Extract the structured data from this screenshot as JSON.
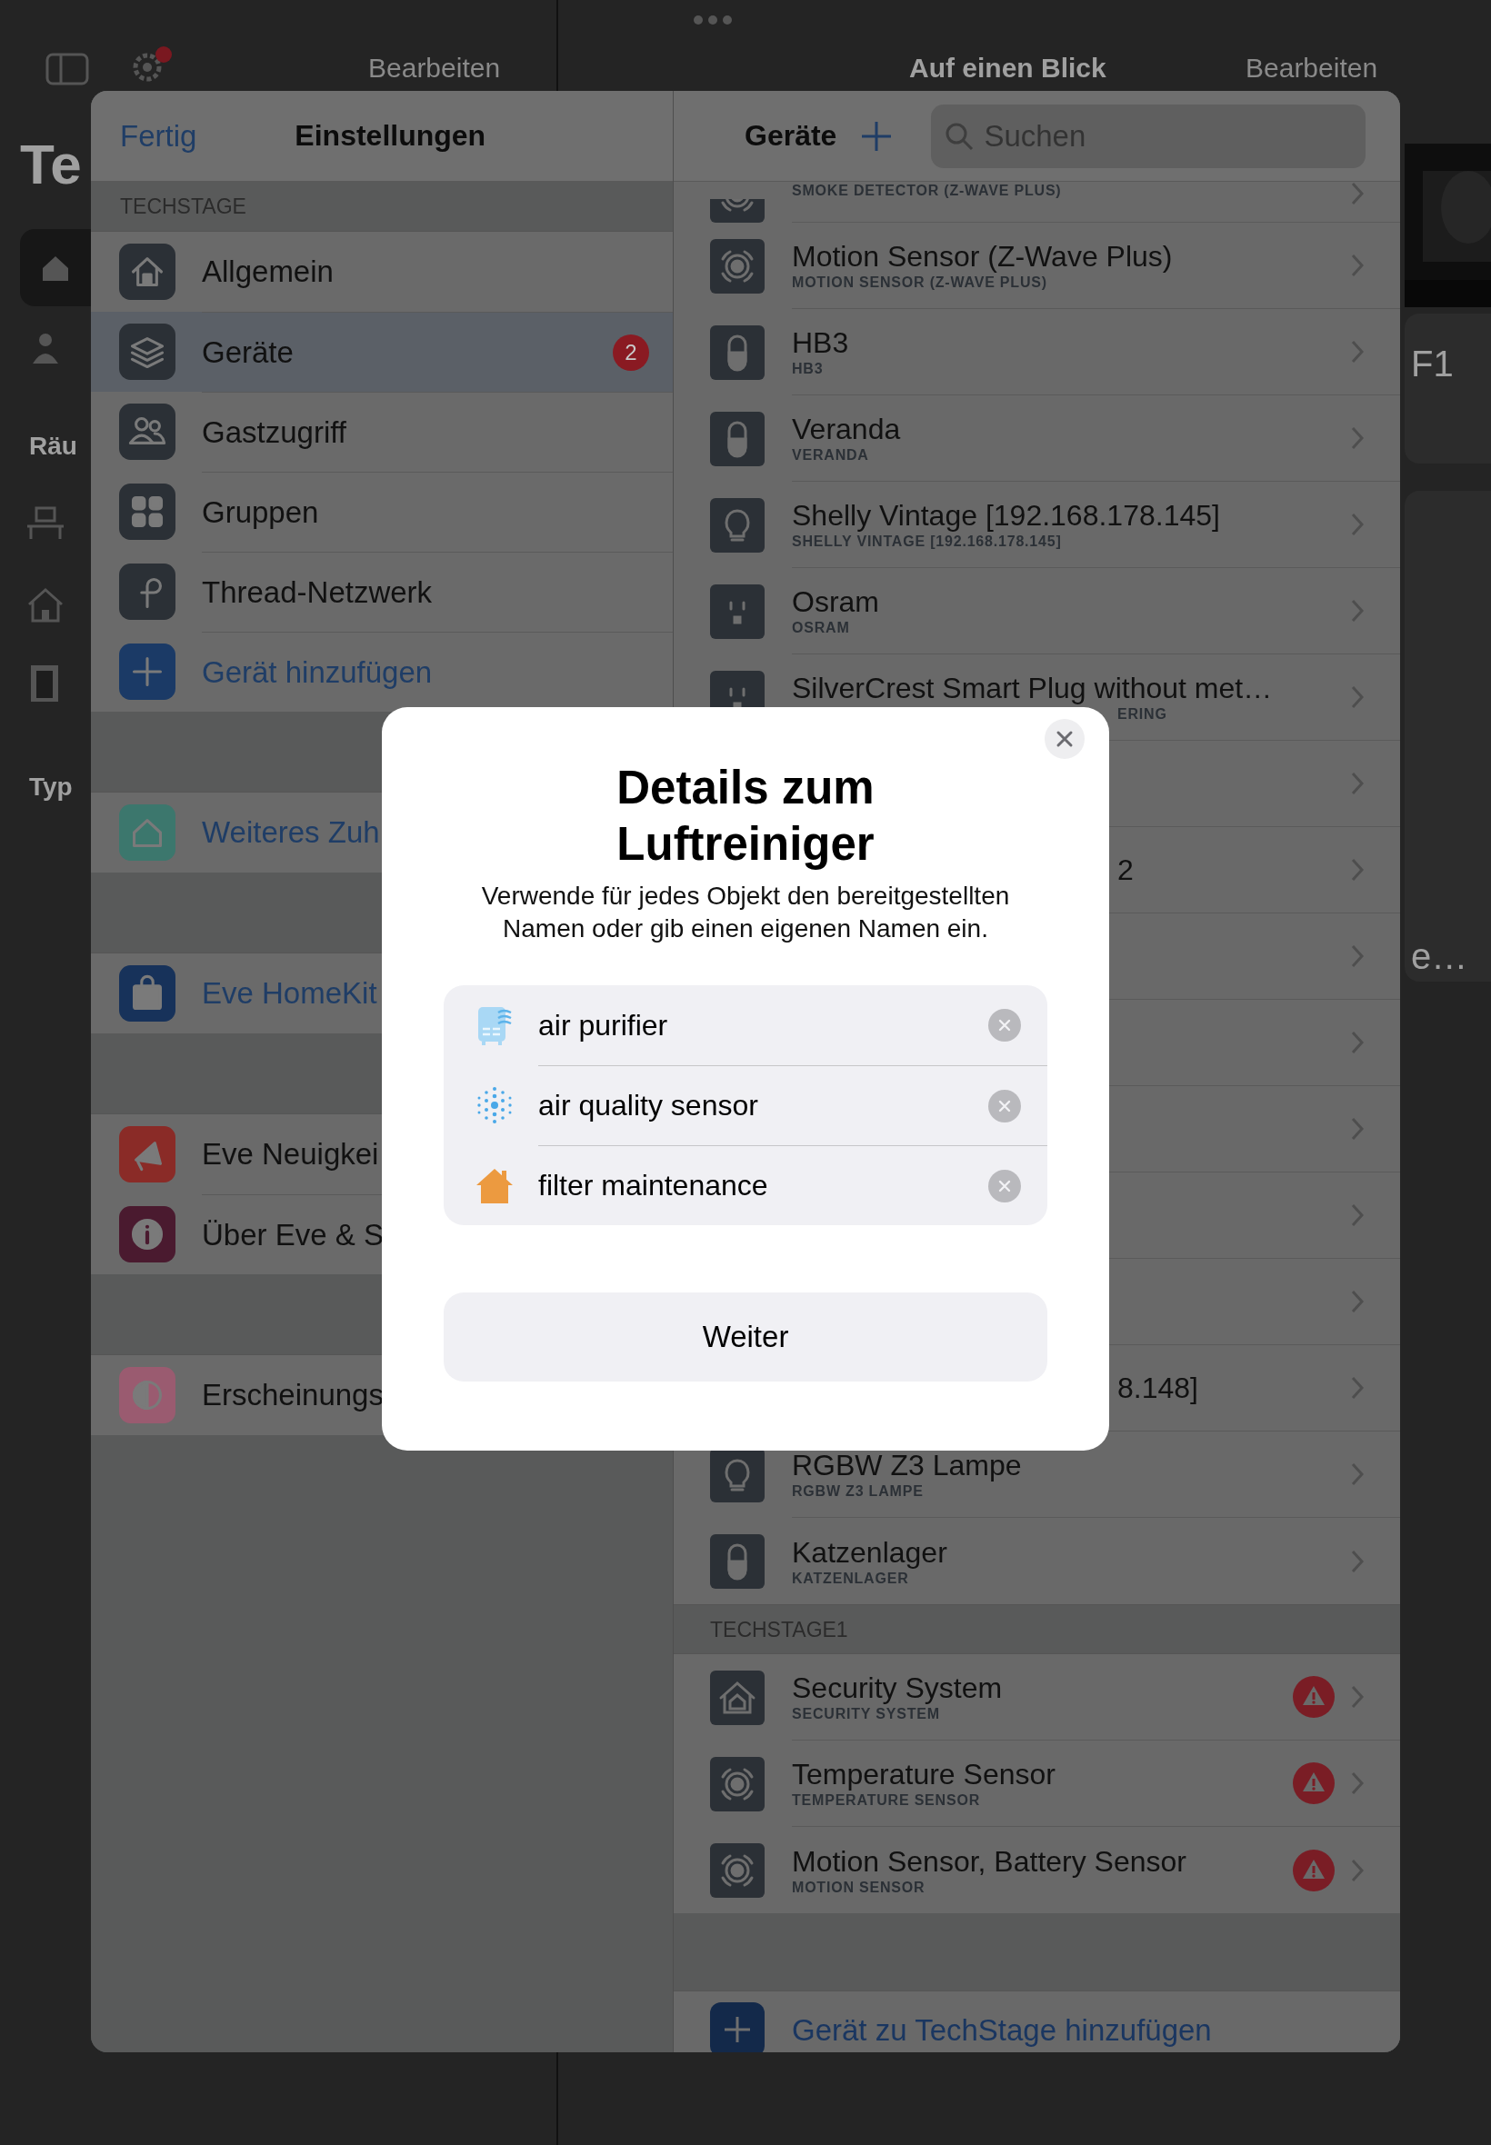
{
  "background": {
    "title": "Te",
    "section_1": "Räu",
    "section_2": "Typ",
    "left_action": "Bearbeiten",
    "center_title": "Auf einen Blick",
    "right_action": "Bearbeiten",
    "tile_1": "F1",
    "tile_2": "e…"
  },
  "settings": {
    "done": "Fertig",
    "title": "Einstellungen",
    "section": "TECHSTAGE",
    "groups": [
      [
        {
          "label": "Allgemein",
          "kind": "home",
          "selected": false
        },
        {
          "label": "Geräte",
          "kind": "devices",
          "selected": true,
          "badge": "2"
        },
        {
          "label": "Gastzugriff",
          "kind": "guests",
          "selected": false
        },
        {
          "label": "Gruppen",
          "kind": "groups",
          "selected": false
        },
        {
          "label": "Thread-Netzwerk",
          "kind": "thread",
          "selected": false
        },
        {
          "label": "Gerät hinzufügen",
          "kind": "add",
          "selected": false
        }
      ],
      [
        {
          "label": "Weiteres Zuh",
          "kind": "accessory",
          "selected": false
        }
      ],
      [
        {
          "label": "Eve HomeKit",
          "kind": "shop",
          "selected": false
        }
      ],
      [
        {
          "label": "Eve Neuigkei",
          "kind": "news",
          "selected": false
        },
        {
          "label": "Über Eve & S",
          "kind": "about",
          "selected": false
        }
      ],
      [
        {
          "label": "Erscheinungs",
          "kind": "appearance",
          "selected": false
        }
      ]
    ]
  },
  "devices": {
    "title": "Geräte",
    "search": {
      "placeholder": "Suchen"
    },
    "sections": [
      {
        "rows": [
          {
            "kind": "cut",
            "subtitle": "SMOKE DETECTOR (Z-WAVE PLUS)"
          },
          {
            "kind": "sensor",
            "title": "Motion Sensor (Z-Wave Plus)",
            "subtitle": "MOTION SENSOR (Z-WAVE PLUS)",
            "alert": false
          },
          {
            "kind": "switch",
            "title": "HB3",
            "subtitle": "HB3",
            "alert": false
          },
          {
            "kind": "switch",
            "title": "Veranda",
            "subtitle": "VERANDA",
            "alert": false
          },
          {
            "kind": "bulb",
            "title": "Shelly Vintage [192.168.178.145]",
            "subtitle": "SHELLY VINTAGE [192.168.178.145]",
            "alert": false
          },
          {
            "kind": "outlet",
            "title": "Osram",
            "subtitle": "OSRAM",
            "alert": false
          },
          {
            "kind": "outlet",
            "title": "SilverCrest Smart Plug without met…",
            "subtitle": "ERING",
            "subtitle_covered": true,
            "alert": false
          },
          {
            "kind": "covered"
          },
          {
            "kind": "covered",
            "title": "2"
          },
          {
            "kind": "covered"
          },
          {
            "kind": "covered"
          },
          {
            "kind": "covered"
          },
          {
            "kind": "covered"
          },
          {
            "kind": "covered"
          },
          {
            "kind": "covered",
            "title": "8.148]"
          },
          {
            "kind": "bulb",
            "title": "RGBW Z3 Lampe",
            "subtitle": "RGBW Z3 LAMPE",
            "alert": false
          },
          {
            "kind": "switch",
            "title": "Katzenlager",
            "subtitle": "KATZENLAGER",
            "alert": false
          }
        ]
      },
      {
        "header": "TECHSTAGE1",
        "rows": [
          {
            "kind": "security",
            "title": "Security System",
            "subtitle": "SECURITY SYSTEM",
            "alert": true
          },
          {
            "kind": "sensor",
            "title": "Temperature Sensor",
            "subtitle": "TEMPERATURE SENSOR",
            "alert": true
          },
          {
            "kind": "sensor",
            "title": "Motion Sensor, Battery Sensor",
            "subtitle": "MOTION SENSOR",
            "alert": true
          }
        ]
      }
    ],
    "add_label": "Gerät zu TechStage hinzufügen"
  },
  "dialog": {
    "title": "Details zum Luftreiniger",
    "text": "Verwende für jedes Objekt den bereitgestellten Namen oder gib einen eigenen Namen ein.",
    "fields": [
      {
        "kind": "purifier",
        "value": "air purifier"
      },
      {
        "kind": "air_quality",
        "value": "air quality sensor"
      },
      {
        "kind": "home",
        "value": "filter maintenance"
      }
    ],
    "button": "Weiter"
  }
}
